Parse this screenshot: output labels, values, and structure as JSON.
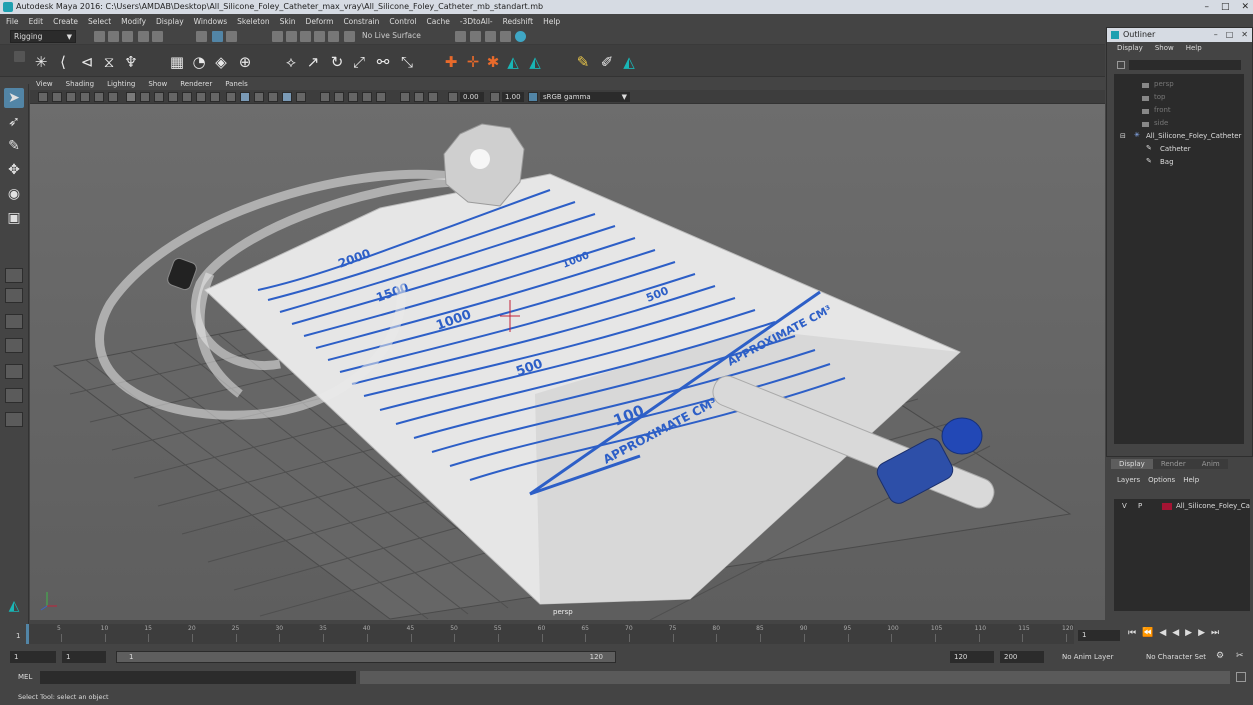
{
  "window": {
    "title": "Autodesk Maya 2016: C:\\Users\\AMDAB\\Desktop\\All_Silicone_Foley_Catheter_max_vray\\All_Silicone_Foley_Catheter_mb_standart.mb",
    "controls": [
      "–",
      "□",
      "✕"
    ]
  },
  "menubar": [
    "File",
    "Edit",
    "Create",
    "Select",
    "Modify",
    "Display",
    "Windows",
    "Skeleton",
    "Skin",
    "Deform",
    "Constrain",
    "Control",
    "Cache",
    "-3DtoAll-",
    "Redshift",
    "Help"
  ],
  "statusline": {
    "mode": "Rigging",
    "live_surface": "No Live Surface"
  },
  "viewport": {
    "menu": [
      "View",
      "Shading",
      "Lighting",
      "Show",
      "Renderer",
      "Panels"
    ],
    "exposure": "0.00",
    "gamma": "1.00",
    "color_space": "sRGB gamma",
    "camera_label": "persp"
  },
  "bag_labels": {
    "m2000": "2000",
    "m1500": "1500",
    "m1000": "1000",
    "m500": "500",
    "m100": "100",
    "approx": "APPROXIMATE CM³",
    "back1000": "1000",
    "back500": "500",
    "back_approx": "APPROXIMATE CM³"
  },
  "outliner": {
    "title": "Outliner",
    "menu": [
      "Display",
      "Show",
      "Help"
    ],
    "items": [
      {
        "label": "persp",
        "dim": true
      },
      {
        "label": "top",
        "dim": true
      },
      {
        "label": "front",
        "dim": true
      },
      {
        "label": "side",
        "dim": true
      },
      {
        "label": "All_Silicone_Foley_Catheter",
        "dim": false
      },
      {
        "label": "Catheter",
        "dim": false
      },
      {
        "label": "Bag",
        "dim": false
      }
    ]
  },
  "layers": {
    "tabs": [
      "Display",
      "Render",
      "Anim"
    ],
    "menu": [
      "Layers",
      "Options",
      "Help"
    ],
    "row": {
      "v": "V",
      "p": "P",
      "name": "All_Silicone_Foley_Catheter",
      "color": "#a31433"
    }
  },
  "timeline": {
    "ticks": [
      "5",
      "10",
      "15",
      "20",
      "25",
      "30",
      "35",
      "40",
      "45",
      "50",
      "55",
      "60",
      "65",
      "70",
      "75",
      "80",
      "85",
      "90",
      "95",
      "100",
      "105",
      "110",
      "115",
      "120"
    ],
    "current_frame": "1",
    "current_label": "1"
  },
  "range": {
    "start": "1",
    "start_inner": "1",
    "range_start": "1",
    "range_end": "120",
    "end_inner": "120",
    "end": "200",
    "anim_layer": "No Anim Layer",
    "character_set": "No Character Set"
  },
  "cmdline": {
    "label": "MEL"
  },
  "help": "Select Tool: select an object"
}
